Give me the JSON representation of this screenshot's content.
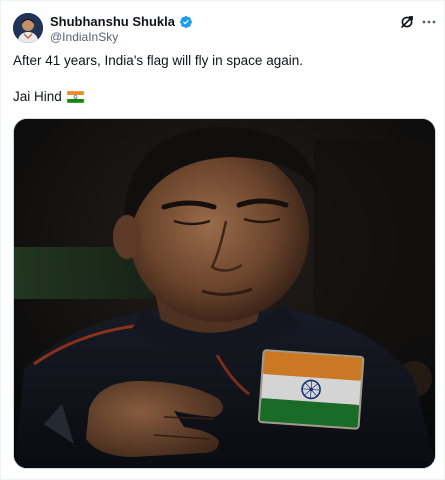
{
  "author": {
    "display_name": "Shubhanshu Shukla",
    "handle": "@IndiaInSky",
    "verified": true,
    "verified_color": "#1d9bf0"
  },
  "header_icons": [
    "grok-icon",
    "more-options-icon"
  ],
  "tweet": {
    "line1": "After 41 years, India's flag will fly in space again.",
    "line2": "Jai Hind",
    "line2_emoji": "india-flag-emoji"
  },
  "media": {
    "kind": "photo",
    "description_icon": "astronaut-photo"
  },
  "colors": {
    "text_primary": "#0f1419",
    "text_secondary": "#536471",
    "saffron": "#e8892b",
    "green": "#1f7a2e",
    "chakra_blue": "#1a3a8a"
  }
}
